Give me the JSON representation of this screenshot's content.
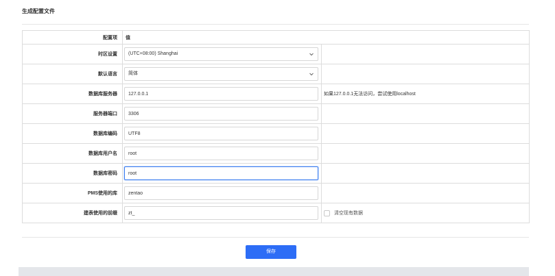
{
  "page": {
    "title": "生成配置文件"
  },
  "table": {
    "header": {
      "label": "配置项",
      "value": "值"
    },
    "rows": [
      {
        "label": "时区设置",
        "type": "select",
        "value": "(UTC+08:00) Shanghai",
        "note": ""
      },
      {
        "label": "默认语言",
        "type": "select",
        "value": "简体",
        "note": ""
      },
      {
        "label": "数据库服务器",
        "type": "input",
        "value": "127.0.0.1",
        "note": "如果127.0.0.1无法访问，尝试使用localhost"
      },
      {
        "label": "服务器端口",
        "type": "input",
        "value": "3306",
        "note": ""
      },
      {
        "label": "数据库编码",
        "type": "input",
        "value": "UTF8",
        "note": ""
      },
      {
        "label": "数据库用户名",
        "type": "input",
        "value": "root",
        "note": ""
      },
      {
        "label": "数据库密码",
        "type": "input",
        "value": "root",
        "note": ""
      },
      {
        "label": "PMS使用的库",
        "type": "input",
        "value": "zentao",
        "note": ""
      },
      {
        "label": "建表使用的前缀",
        "type": "input",
        "value": "zt_",
        "note": ""
      }
    ],
    "clear_data_checkbox": {
      "label": "清空现有数据",
      "checked": false
    }
  },
  "actions": {
    "save_label": "保存"
  },
  "colors": {
    "primary": "#2d6df6",
    "focus_border": "#3d7ef0",
    "border": "#dcdcdc"
  }
}
